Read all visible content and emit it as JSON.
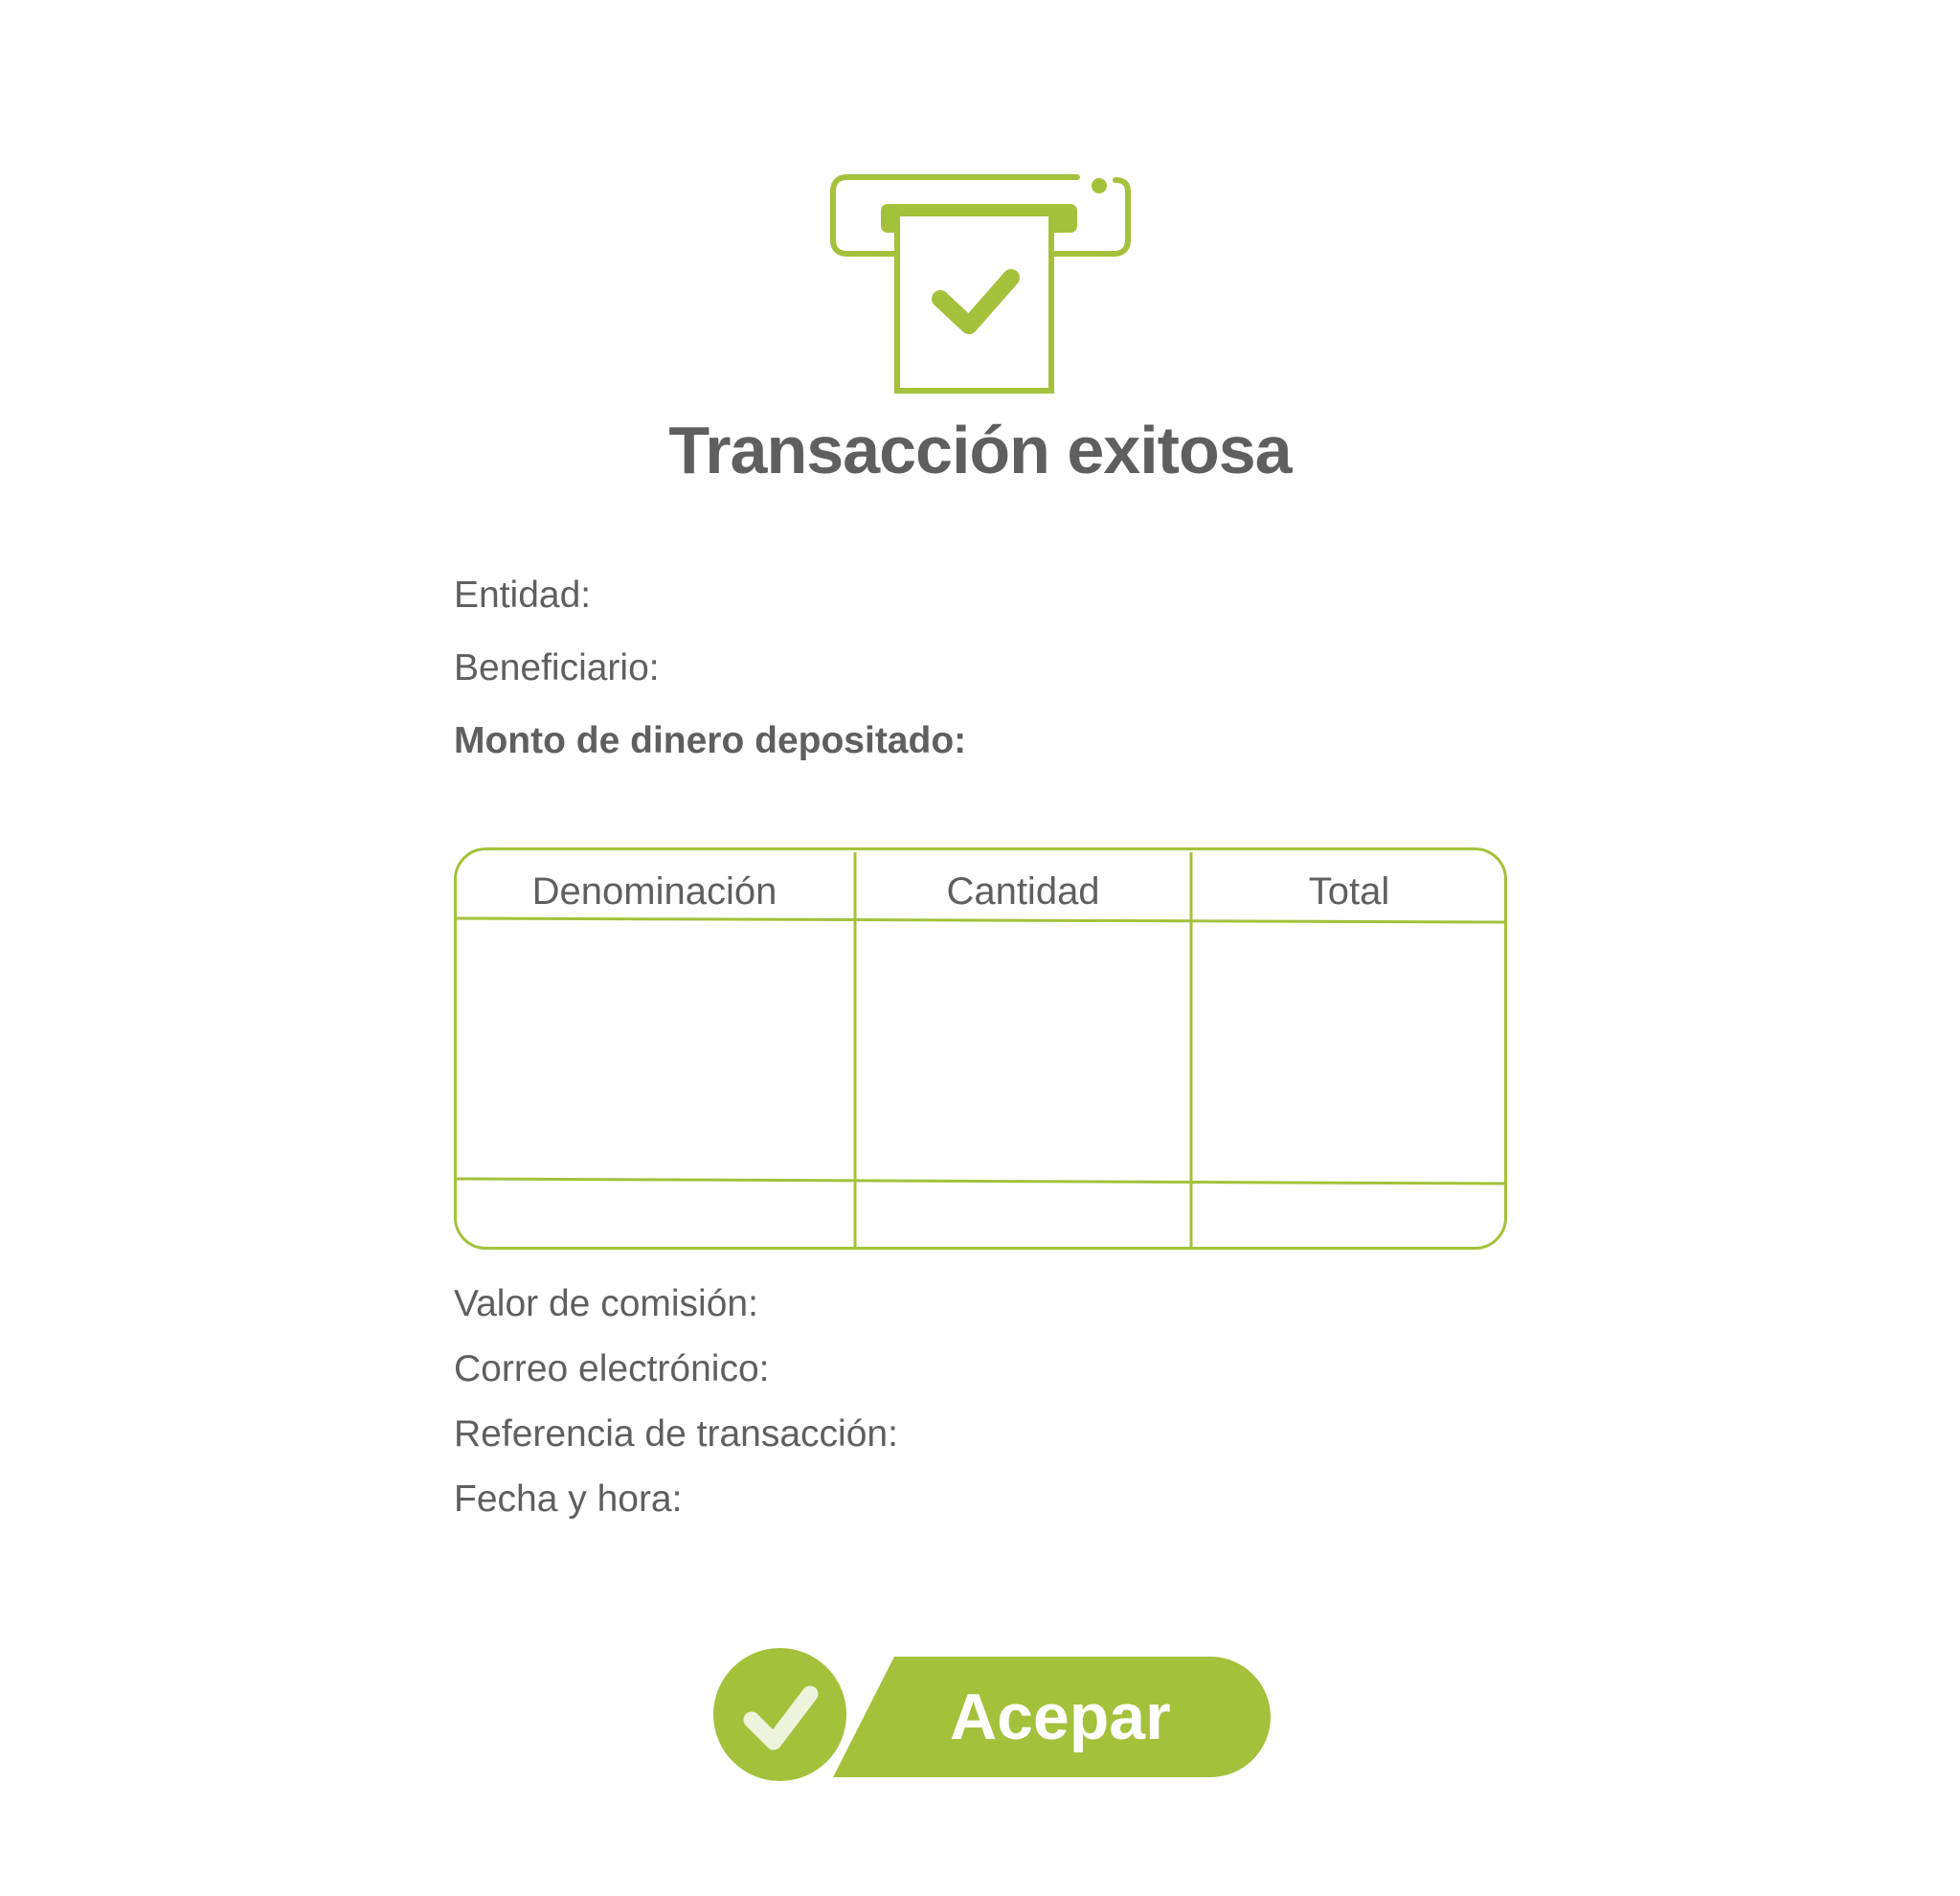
{
  "header": {
    "icon": "receipt-check-icon",
    "title": "Transacción exitosa"
  },
  "fields": {
    "entidad": "Entidad:",
    "beneficiario": "Beneficiario:",
    "monto": "Monto de dinero depositado:"
  },
  "table": {
    "columns": [
      "Denominación",
      "Cantidad",
      "Total"
    ]
  },
  "details": {
    "comision": "Valor de comisión:",
    "correo": "Correo electrónico:",
    "referencia": "Referencia de transacción:",
    "fecha": "Fecha y hora:"
  },
  "actions": {
    "accept_label": "Acepar",
    "accept_icon": "check-icon"
  },
  "colors": {
    "accent": "#a4c13b",
    "text": "#5f5f5f"
  }
}
